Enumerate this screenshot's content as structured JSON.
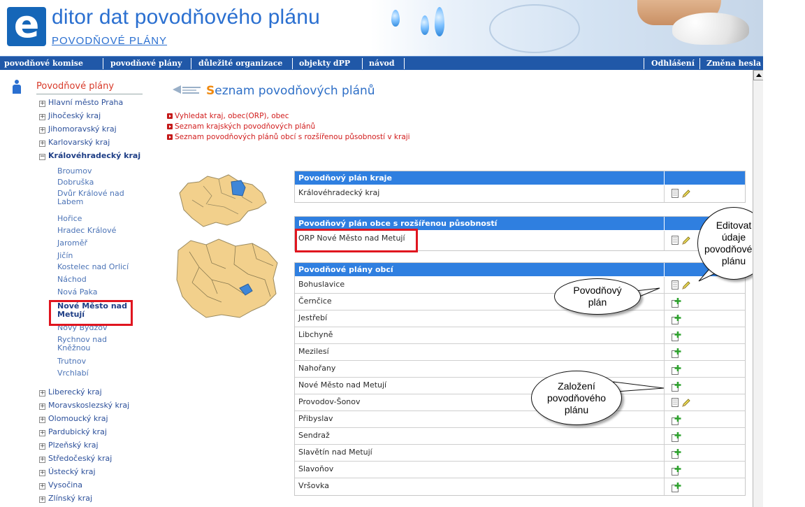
{
  "header": {
    "logo_letter": "e",
    "app_title": "ditor dat povodňového plánu",
    "app_subtitle": "POVODŇOVÉ PLÁNY"
  },
  "nav": {
    "items": [
      "povodňové komise",
      "povodňové plány",
      "důležité organizace",
      "objekty dPP",
      "návod"
    ],
    "right": [
      "Odhlášení",
      "Změna hesla"
    ]
  },
  "sidebar": {
    "title": "Povodňové plány",
    "regions_top": [
      {
        "label": "Hlavní město Praha",
        "toggle": "+"
      },
      {
        "label": "Jihočeský kraj",
        "toggle": "+"
      },
      {
        "label": "Jihomoravský kraj",
        "toggle": "+"
      },
      {
        "label": "Karlovarský kraj",
        "toggle": "+"
      },
      {
        "label": "Královéhradecký kraj",
        "toggle": "−"
      }
    ],
    "cities": [
      "Broumov",
      "Dobruška",
      "Dvůr Králové nad Labem",
      "Hořice",
      "Hradec Králové",
      "Jaroměř",
      "Jičín",
      "Kostelec nad Orlicí",
      "Náchod",
      "Nová Paka",
      "Nové Město nad Metují",
      "Nový Bydžov",
      "Rychnov nad Kněžnou",
      "Trutnov",
      "Vrchlabí"
    ],
    "selected_city": "Nové Město nad Metují",
    "regions_bottom": [
      "Liberecký kraj",
      "Moravskoslezský kraj",
      "Olomoucký kraj",
      "Pardubický kraj",
      "Plzeňský kraj",
      "Středočeský kraj",
      "Ústecký kraj",
      "Vysočina",
      "Zlínský kraj"
    ],
    "toggle_plus": "+"
  },
  "main": {
    "title_cap": "S",
    "title_rest": "eznam povodňových plánů",
    "links": [
      "Vyhledat kraj, obec(ORP), obec",
      "Seznam krajských povodňových plánů",
      "Seznam povodňových plánů obcí s rozšířenou působností v kraji"
    ],
    "table_region": {
      "header": "Povodňový plán kraje",
      "rows": [
        {
          "name": "Královéhradecký kraj",
          "action": "edit"
        }
      ]
    },
    "table_orp": {
      "header": "Povodňový plán obce s rozšířenou působností",
      "rows": [
        {
          "name": "ORP Nové Město nad Metují",
          "action": "edit"
        }
      ]
    },
    "table_municipal": {
      "header": "Povodňové plány obcí",
      "rows": [
        {
          "name": "Bohuslavice",
          "action": "edit"
        },
        {
          "name": "Černčice",
          "action": "add"
        },
        {
          "name": "Jestřebí",
          "action": "add"
        },
        {
          "name": "Libchyně",
          "action": "add"
        },
        {
          "name": "Mezilesí",
          "action": "add"
        },
        {
          "name": "Nahořany",
          "action": "add"
        },
        {
          "name": "Nové Město nad Metují",
          "action": "add"
        },
        {
          "name": "Provodov-Šonov",
          "action": "edit"
        },
        {
          "name": "Přibyslav",
          "action": "add"
        },
        {
          "name": "Sendraž",
          "action": "add"
        },
        {
          "name": "Slavětín nad Metují",
          "action": "add"
        },
        {
          "name": "Slavoňov",
          "action": "add"
        },
        {
          "name": "Vršovka",
          "action": "add"
        }
      ]
    }
  },
  "callouts": {
    "edit": "Editovat\núdaje\npovodňového\nplánu",
    "plan": "Povodňový\nplán",
    "create": "Založení\npovodňového\nplánu"
  },
  "colors": {
    "nav_bg": "#2058a8",
    "table_header": "#2f7fe0",
    "highlight_frame": "#e0151f",
    "link_red": "#d11c1c"
  }
}
